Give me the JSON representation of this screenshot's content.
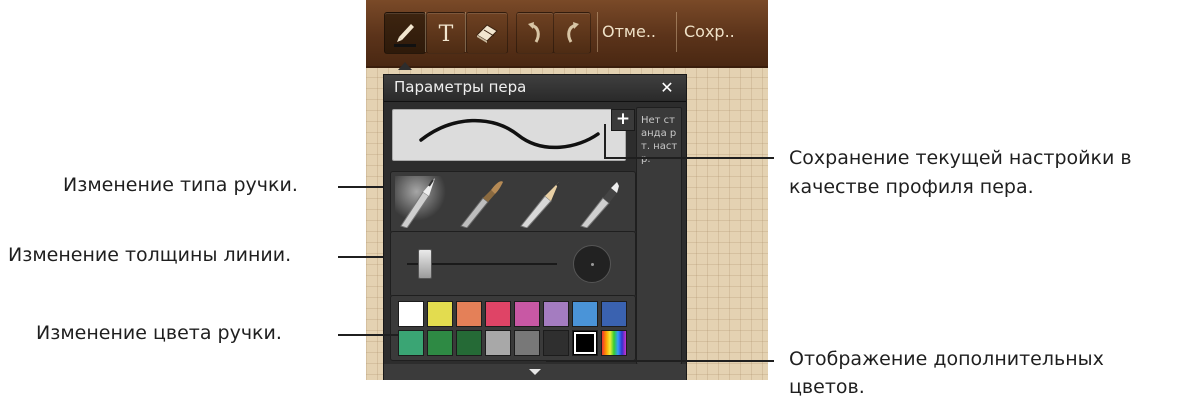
{
  "toolbar": {
    "cancel_label": "Отме..",
    "save_label": "Сохр.."
  },
  "panel": {
    "title": "Параметры пера",
    "close_glyph": "✕",
    "plus_glyph": "+",
    "presets_label": "Нет станда рт. настр."
  },
  "colors": [
    "#ffffff",
    "#e3dc4f",
    "#e48058",
    "#df4466",
    "#c858a4",
    "#a47cc0",
    "#4a94d8",
    "#3a62b0",
    "#3aa574",
    "#2e8a44",
    "#256a36",
    "#a8a8a8",
    "#787878",
    "#2f2f2f",
    "#000000",
    "rainbow"
  ],
  "thickness_level": 0.12,
  "callouts": {
    "pen_type": "Изменение типа ручки.",
    "line_thickness": "Изменение толщины линии.",
    "pen_color": "Изменение цвета ручки.",
    "save_profile_line1": "Сохранение текущей настройки в",
    "save_profile_line2": "качестве профиля пера.",
    "more_colors_line1": "Отображение дополнительных",
    "more_colors_line2": "цветов."
  },
  "icons": [
    "pen-icon",
    "text-icon",
    "eraser-icon",
    "undo-icon",
    "redo-icon",
    "close-icon",
    "plus-icon",
    "chevron-down-icon"
  ]
}
